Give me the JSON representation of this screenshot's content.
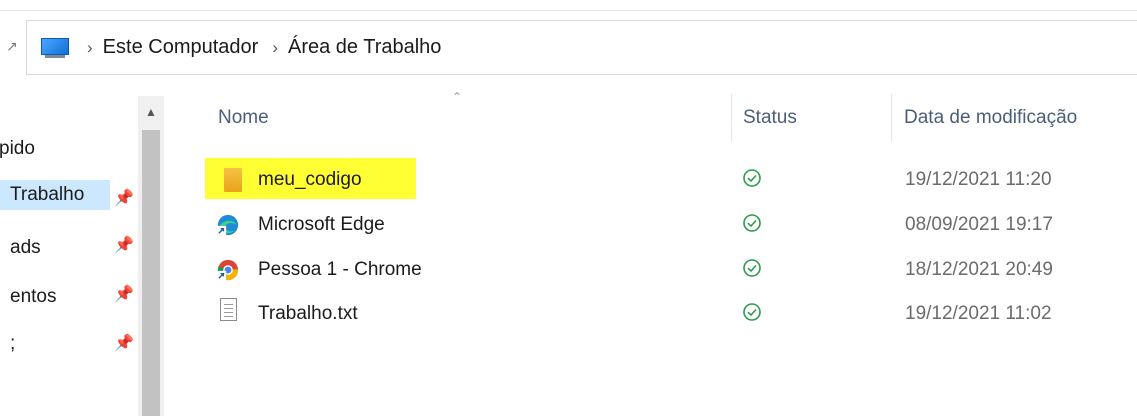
{
  "breadcrumb": [
    "Este Computador",
    "Área de Trabalho"
  ],
  "nav": {
    "items": [
      {
        "label": "pido",
        "pinned": false,
        "active": false
      },
      {
        "label": "Trabalho",
        "pinned": true,
        "active": true
      },
      {
        "label": "ads",
        "pinned": true,
        "active": false
      },
      {
        "label": "entos",
        "pinned": true,
        "active": false
      },
      {
        "label": ";",
        "pinned": true,
        "active": false
      }
    ]
  },
  "columns": [
    "Nome",
    "Status",
    "Data de modificação"
  ],
  "files": [
    {
      "name": "meu_codigo",
      "type": "folder",
      "status": "sync-ok",
      "date": "19/12/2021 11:20",
      "highlighted": true
    },
    {
      "name": "Microsoft Edge",
      "type": "edge-shortcut",
      "status": "sync-ok",
      "date": "08/09/2021 19:17"
    },
    {
      "name": "Pessoa 1 - Chrome",
      "type": "chrome-shortcut",
      "status": "sync-ok",
      "date": "18/12/2021 20:49"
    },
    {
      "name": "Trabalho.txt",
      "type": "text-file",
      "status": "sync-ok",
      "date": "19/12/2021 11:02"
    }
  ],
  "colors": {
    "highlight": "#ffff33",
    "status_ok": "#2a9d4a",
    "selection": "#cce8ff",
    "header_text": "#4b5e77"
  }
}
